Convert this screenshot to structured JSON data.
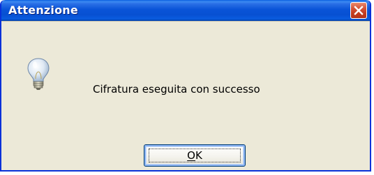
{
  "dialog": {
    "title": "Attenzione",
    "message": "Cifratura eseguita con successo",
    "icon": "lightbulb-icon",
    "ok_mnemonic": "O",
    "ok_rest": "K"
  },
  "colors": {
    "title_bar": "#0750d2",
    "close_button": "#c23a1c",
    "dialog_background": "#ece9d8",
    "window_border": "#0831d9"
  }
}
